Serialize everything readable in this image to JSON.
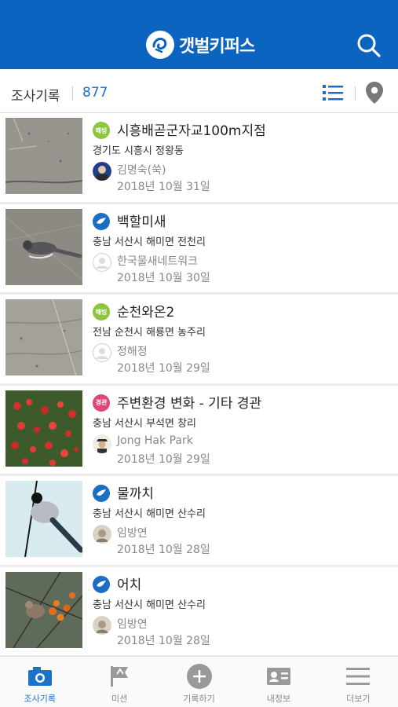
{
  "app": {
    "title": "갯벌키퍼스",
    "brand_color": "#0a64c0",
    "accent_color": "#1a73c8"
  },
  "header": {
    "search_icon": "search-icon"
  },
  "subheader": {
    "title": "조사기록",
    "count": "877",
    "list_icon": "list-icon",
    "map_icon": "map-pin-icon"
  },
  "records": [
    {
      "badge": "해빙",
      "badge_color": "#8cc63f",
      "title": "시흥배곧군자교100m지점",
      "location": "경기도 시흥시 정왕동",
      "author": "김명숙(쑥)",
      "date": "2018년 10월 31일"
    },
    {
      "badge": "bird",
      "badge_color": "#1a6fc4",
      "title": "백할미새",
      "location": "충남 서산시 해미면 전천리",
      "author": "한국물새네트워크",
      "date": "2018년 10월 30일"
    },
    {
      "badge": "해빙",
      "badge_color": "#8cc63f",
      "title": "순천와온2",
      "location": "전남 순천시 해룡면 농주리",
      "author": "정해정",
      "date": "2018년 10월 29일"
    },
    {
      "badge": "경관",
      "badge_color": "#e0457b",
      "title": "주변환경 변화 - 기타 경관",
      "location": "충남 서산시 부석면 창리",
      "author": "Jong Hak Park",
      "date": "2018년 10월 29일"
    },
    {
      "badge": "bird",
      "badge_color": "#1a6fc4",
      "title": "물까치",
      "location": "충남 서산시 해미면 산수리",
      "author": "임방연",
      "date": "2018년 10월 28일"
    },
    {
      "badge": "bird",
      "badge_color": "#1a6fc4",
      "title": "어치",
      "location": "충남 서산시 해미면 산수리",
      "author": "임방연",
      "date": "2018년 10월 28일"
    }
  ],
  "nav": [
    {
      "label": "조사기록",
      "icon": "camera-icon"
    },
    {
      "label": "미션",
      "icon": "flag-icon"
    },
    {
      "label": "기록하기",
      "icon": "plus-icon"
    },
    {
      "label": "내정보",
      "icon": "id-card-icon"
    },
    {
      "label": "더보기",
      "icon": "menu-icon"
    }
  ]
}
